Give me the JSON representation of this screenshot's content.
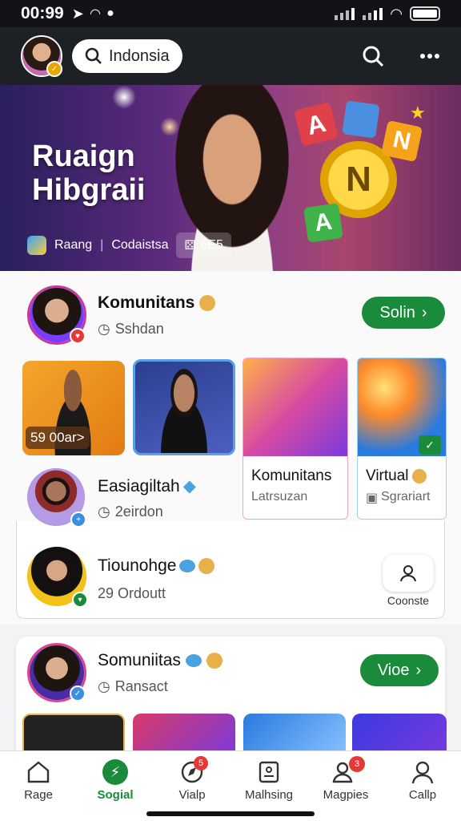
{
  "status": {
    "time": "00:99"
  },
  "topbar": {
    "search_label": "Indonsia"
  },
  "hero": {
    "title_line1": "Ruaign",
    "title_line2": "Hibgraii",
    "chip1": "Raang",
    "chip2": "Codaistsa",
    "chip3": "6E5"
  },
  "section1": {
    "title": "Komunitans",
    "subtitle": "Sshdan",
    "join_label": "Solin"
  },
  "thumbs": [
    {
      "price": "59 00ar>"
    }
  ],
  "tiles": [
    {
      "title": "Komunitans",
      "subtitle": "Latrsuzan"
    },
    {
      "title": "Virtual",
      "subtitle": "Sgrariart"
    }
  ],
  "row2": {
    "title": "Easiagiltah",
    "subtitle": "2eirdon"
  },
  "row3": {
    "title": "Tiounohge",
    "subtitle": "29 Ordoutt",
    "connect_label": "Coonste"
  },
  "section2": {
    "title": "Somuniitas",
    "subtitle": "Ransact",
    "view_label": "Vioe"
  },
  "nav": [
    {
      "label": "Rage"
    },
    {
      "label": "Sogial"
    },
    {
      "label": "Vialp",
      "badge": "5"
    },
    {
      "label": "Malhsing"
    },
    {
      "label": "Magpies",
      "badge": "3"
    },
    {
      "label": "Callp"
    }
  ],
  "colors": {
    "accent": "#1a8a3b",
    "dark": "#1d2024",
    "badge_red": "#e53935"
  }
}
